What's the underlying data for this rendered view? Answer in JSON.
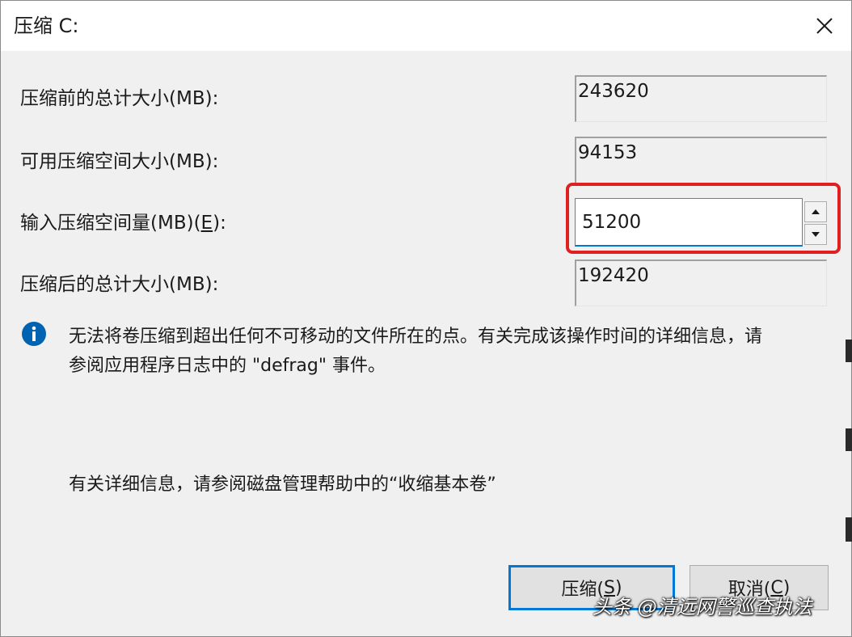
{
  "window": {
    "title": "压缩 C:",
    "close_icon": "close-icon"
  },
  "fields": {
    "total_before": {
      "label": "压缩前的总计大小(MB):",
      "value": "243620"
    },
    "available": {
      "label": "可用压缩空间大小(MB):",
      "value": "94153"
    },
    "input": {
      "label_prefix": "输入压缩空间量(MB)(",
      "label_mnemonic": "E",
      "label_suffix": "):",
      "value": "51200"
    },
    "total_after": {
      "label": "压缩后的总计大小(MB):",
      "value": "192420"
    }
  },
  "info": {
    "icon": "info-icon",
    "text_line1": "无法将卷压缩到超出任何不可移动的文件所在的点。有关完成该操作时间的详细信息，请",
    "text_line2": "参阅应用程序日志中的 \"defrag\" 事件。",
    "help_text": "有关详细信息，请参阅磁盘管理帮助中的“收缩基本卷”"
  },
  "buttons": {
    "shrink": {
      "prefix": "压缩(",
      "mnemonic": "S",
      "suffix": ")"
    },
    "cancel": {
      "prefix": "取消(",
      "mnemonic": "C",
      "suffix": ")"
    }
  },
  "watermark": "头条 @清远网警巡查执法",
  "colors": {
    "highlight": "#e02020",
    "focus_blue": "#0078d7",
    "info_blue": "#0063b1"
  }
}
